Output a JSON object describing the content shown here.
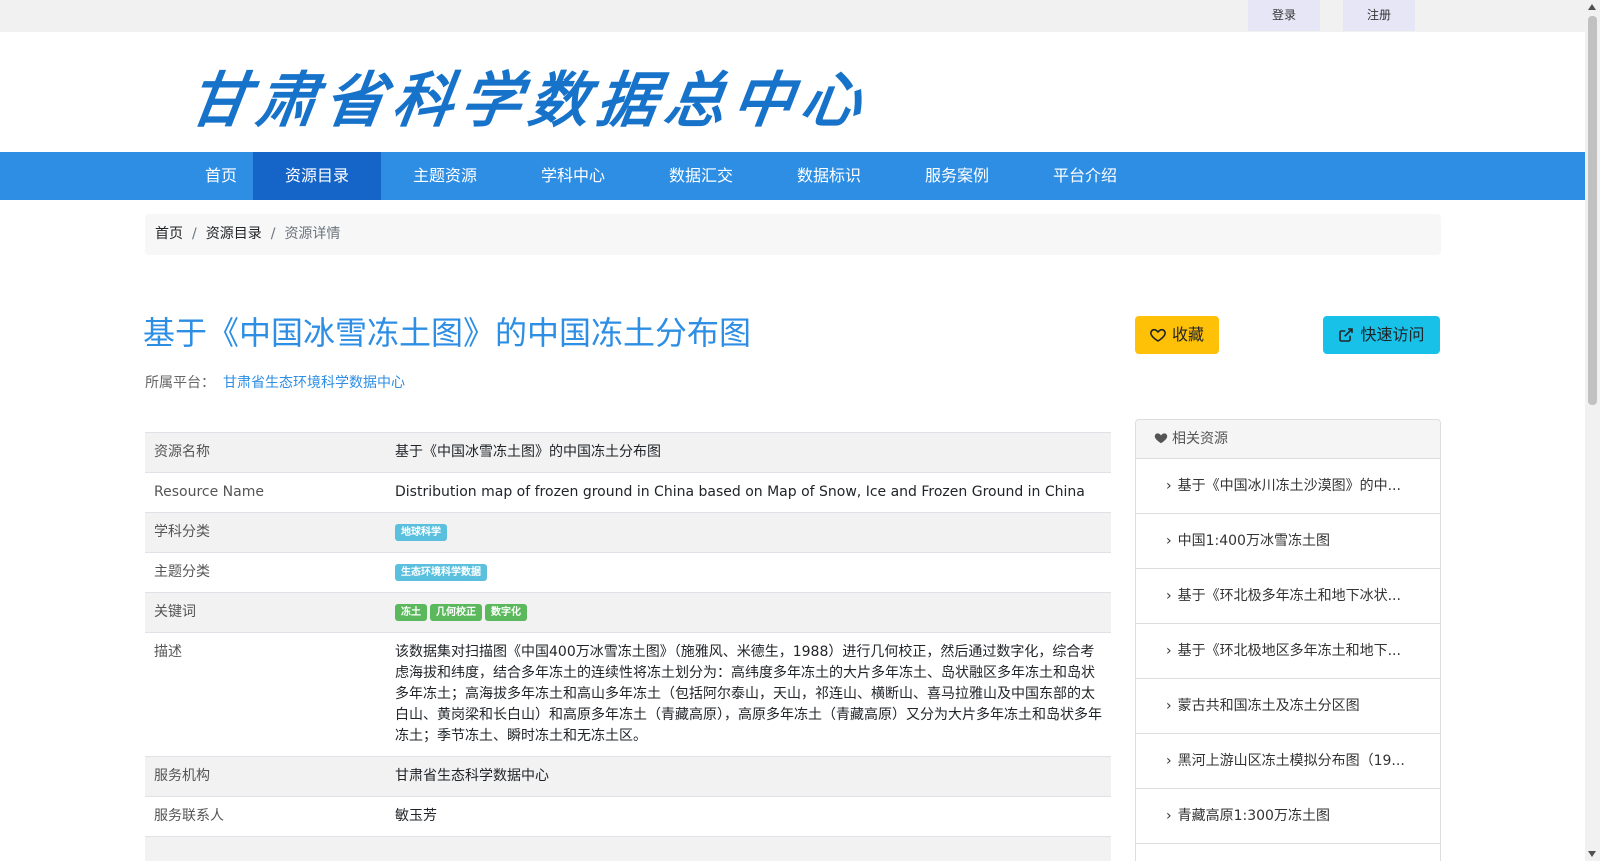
{
  "topbar": {
    "login": "登录",
    "register": "注册"
  },
  "logo": "甘肃省科学数据总中心",
  "nav": {
    "items": [
      "首页",
      "资源目录",
      "主题资源",
      "学科中心",
      "数据汇交",
      "数据标识",
      "服务案例",
      "平台介绍"
    ],
    "active_index": 1
  },
  "breadcrumb": {
    "home": "首页",
    "catalog": "资源目录",
    "current": "资源详情"
  },
  "resource": {
    "title": "基于《中国冰雪冻土图》的中国冻土分布图",
    "platform_label": "所属平台：",
    "platform_value": "甘肃省生态环境科学数据中心",
    "fav_button": "收藏",
    "visit_button": "快速访问"
  },
  "details": {
    "name_label": "资源名称",
    "name_value": "基于《中国冰雪冻土图》的中国冻土分布图",
    "en_label": "Resource Name",
    "en_value": "Distribution map of frozen ground in China based on Map of Snow, Ice and Frozen Ground in China",
    "discipline_label": "学科分类",
    "discipline_tag": "地球科学",
    "theme_label": "主题分类",
    "theme_tag": "生态环境科学数据",
    "keywords_label": "关键词",
    "keywords": [
      "冻土",
      "几何校正",
      "数字化"
    ],
    "desc_label": "描述",
    "desc_value": "该数据集对扫描图《中国400万冰雪冻土图》（施雅风、米德生，1988）进行几何校正，然后通过数字化，综合考虑海拔和纬度，结合多年冻土的连续性将冻土划分为：高纬度多年冻土的大片多年冻土、岛状融区多年冻土和岛状多年冻土；高海拔多年冻土和高山多年冻土（包括阿尔泰山，天山，祁连山、横断山、喜马拉雅山及中国东部的太白山、黄岗梁和长白山）和高原多年冻土（青藏高原），高原多年冻土（青藏高原）又分为大片多年冻土和岛状多年冻土；季节冻土、瞬时冻土和无冻土区。",
    "org_label": "服务机构",
    "org_value": "甘肃省生态科学数据中心",
    "contact_label": "服务联系人",
    "contact_value": "敏玉芳"
  },
  "related": {
    "header": "相关资源",
    "items": [
      "基于《中国冰川冻土沙漠图》的中...",
      "中国1:400万冰雪冻土图",
      "基于《环北极多年冻土和地下冰状...",
      "基于《环北极地区多年冻土和地下...",
      "蒙古共和国冻土及冻土分区图",
      "黑河上游山区冻土模拟分布图（19...",
      "青藏高原1:300万冻土图"
    ]
  },
  "colors": {
    "brand": "#2d8ee4",
    "nav_active": "#1565c8",
    "fav": "#ffc107",
    "visit": "#17c1e8"
  }
}
